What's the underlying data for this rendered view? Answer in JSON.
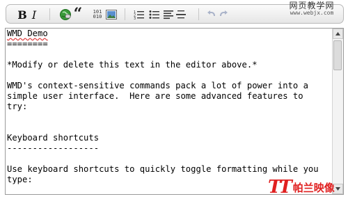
{
  "toolbar": {
    "bold": "B",
    "italic": "I",
    "quote": "“",
    "code_lines": [
      "101",
      "010"
    ],
    "icons": [
      "bold-icon",
      "italic-icon",
      "link-icon",
      "blockquote-icon",
      "code-icon",
      "image-icon",
      "numbered-list-icon",
      "bulleted-list-icon",
      "heading-icon",
      "horizontal-rule-icon",
      "undo-icon",
      "redo-icon"
    ]
  },
  "watermark": {
    "title": "网页教学网",
    "url": "www.webjx.com"
  },
  "editor": {
    "lines": [
      "WMD Demo",
      "========",
      "",
      "*Modify or delete this text in the editor above.*",
      "",
      "WMD's context-sensitive commands pack a lot of power into a",
      "simple user interface.  Here are some advanced features to",
      "try:",
      "",
      "",
      "Keyboard shortcuts",
      "------------------",
      "",
      "Use keyboard shortcuts to quickly toggle formatting while you",
      "type:"
    ]
  },
  "brand": {
    "logo": "TT",
    "name": "帕兰映像"
  },
  "colors": {
    "toolbar_border": "#b9b9b9",
    "editor_border": "#9a9a9a",
    "brand_red": "#e02020"
  }
}
